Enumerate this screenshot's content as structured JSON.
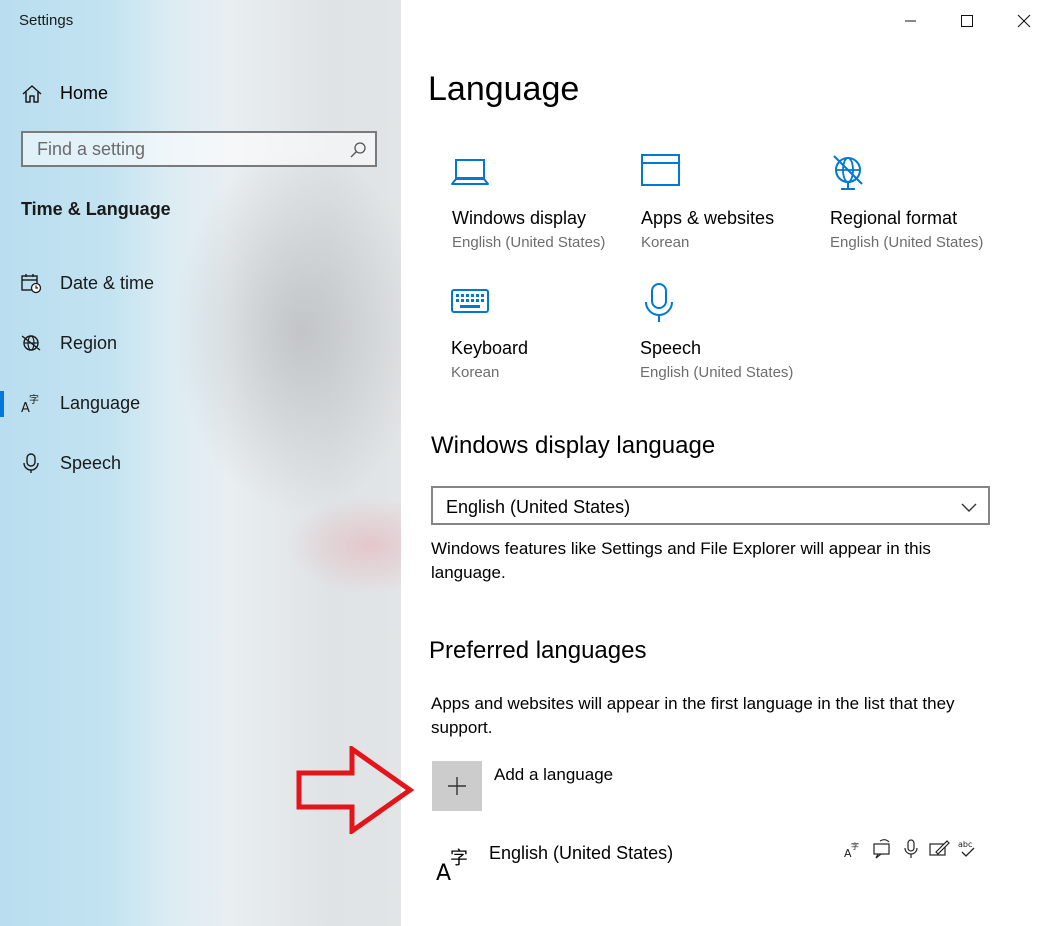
{
  "window": {
    "title": "Settings"
  },
  "sidebar": {
    "home_label": "Home",
    "search_placeholder": "Find a setting",
    "section_title": "Time & Language",
    "items": [
      {
        "label": "Date & time",
        "icon": "calendar-clock-icon"
      },
      {
        "label": "Region",
        "icon": "globe-icon"
      },
      {
        "label": "Language",
        "icon": "language-icon",
        "active": true
      },
      {
        "label": "Speech",
        "icon": "microphone-icon"
      }
    ]
  },
  "main": {
    "title": "Language",
    "tiles": [
      {
        "title": "Windows display",
        "subtitle": "English (United States)",
        "icon": "laptop-icon"
      },
      {
        "title": "Apps & websites",
        "subtitle": "Korean",
        "icon": "browser-window-icon"
      },
      {
        "title": "Regional format",
        "subtitle": "English (United States)",
        "icon": "globe-icon"
      },
      {
        "title": "Keyboard",
        "subtitle": "Korean",
        "icon": "keyboard-icon"
      },
      {
        "title": "Speech",
        "subtitle": "English (United States)",
        "icon": "microphone-icon"
      }
    ],
    "display_language": {
      "heading": "Windows display language",
      "selected": "English (United States)",
      "description": "Windows features like Settings and File Explorer will appear in this language."
    },
    "preferred": {
      "heading": "Preferred languages",
      "description": "Apps and websites will appear in the first language in the list that they support.",
      "add_label": "Add a language",
      "languages": [
        {
          "name": "English (United States)"
        }
      ]
    }
  },
  "colors": {
    "accent": "#0078d7",
    "annotation": "#e3151a"
  }
}
